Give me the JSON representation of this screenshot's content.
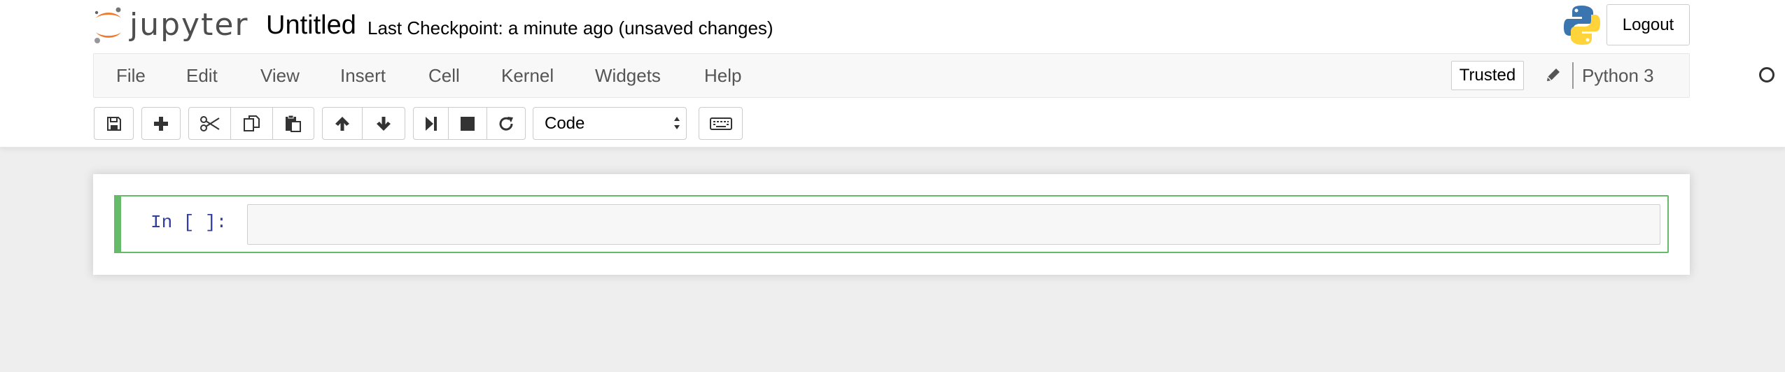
{
  "header": {
    "logo_text": "jupyter",
    "notebook_title": "Untitled",
    "checkpoint": "Last Checkpoint: a minute ago (unsaved changes)",
    "logout_label": "Logout"
  },
  "menubar": {
    "items": [
      "File",
      "Edit",
      "View",
      "Insert",
      "Cell",
      "Kernel",
      "Widgets",
      "Help"
    ],
    "trusted_label": "Trusted",
    "kernel_name": "Python 3"
  },
  "toolbar": {
    "cell_type": "Code",
    "icons": [
      "save-icon",
      "plus-icon",
      "cut-icon",
      "copy-icon",
      "paste-icon",
      "arrow-up-icon",
      "arrow-down-icon",
      "run-icon",
      "stop-icon",
      "restart-icon",
      "keyboard-icon"
    ]
  },
  "cell": {
    "prompt": "In [ ]:"
  },
  "colors": {
    "cell_selected_border": "#66bb6a",
    "prompt_color": "#303f9f",
    "menu_text": "#555555"
  }
}
